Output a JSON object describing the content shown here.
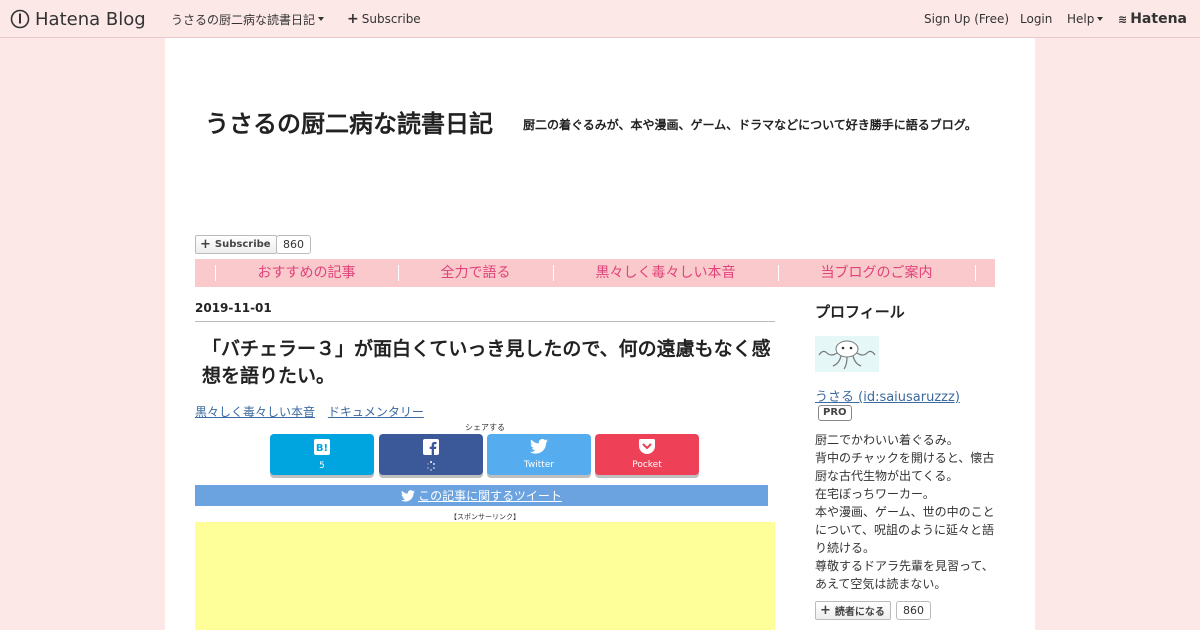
{
  "topbar": {
    "logo": "Hatena Blog",
    "blog_menu": "うさるの厨二病な読書日記",
    "subscribe": "Subscribe",
    "signup": "Sign Up (Free)",
    "login": "Login",
    "help": "Help",
    "hatena": "Hatena"
  },
  "header": {
    "title": "うさるの厨二病な読書日記",
    "description": "厨二の着ぐるみが、本や漫画、ゲーム、ドラマなどについて好き勝手に語るブログ。",
    "subscribe_label": "Subscribe",
    "subscriber_count": "860"
  },
  "nav": {
    "items": [
      {
        "label": "おすすめの記事"
      },
      {
        "label": "全力で語る"
      },
      {
        "label": "黒々しく毒々しい本音"
      },
      {
        "label": "当ブログのご案内"
      }
    ]
  },
  "entry": {
    "date": "2019-11-01",
    "title": "「バチェラー３」が面白くていっき見したので、何の遠慮もなく感想を語りたい。",
    "categories": [
      "黒々しく毒々しい本音",
      "ドキュメンタリー"
    ],
    "share_label": "シェアする",
    "share": {
      "hatebu_count": "5",
      "twitter_label": "Twitter",
      "pocket_label": "Pocket"
    },
    "tweet_link": "この記事に関するツイート",
    "sponsor_label": "【スポンサーリンク】"
  },
  "sidebar": {
    "heading": "プロフィール",
    "name": "うさる (id:saiusaruzzz)",
    "badge": "PRO",
    "bio": [
      "厨二でかわいい着ぐるみ。",
      "背中のチャックを開けると、懐古",
      "厨な古代生物が出てくる。",
      "在宅ぼっちワーカー。",
      "本や漫画、ゲーム、世の中のこと",
      "について、呪詛のように延々と語",
      "り続ける。",
      "尊敬するドアラ先輩を見習って、",
      "あえて空気は読まない。"
    ],
    "reader_label": "読者になる",
    "reader_count": "860"
  },
  "colors": {
    "background": "#fde8e8",
    "nav_background": "#f9c9cb",
    "nav_text": "#e0427a",
    "link": "#3b6aa0",
    "hatebu": "#00a4de",
    "facebook": "#3b5998",
    "twitter": "#55acee",
    "pocket": "#ee4056",
    "tweet_bar": "#6aa3e0",
    "ad": "#ffff99"
  }
}
